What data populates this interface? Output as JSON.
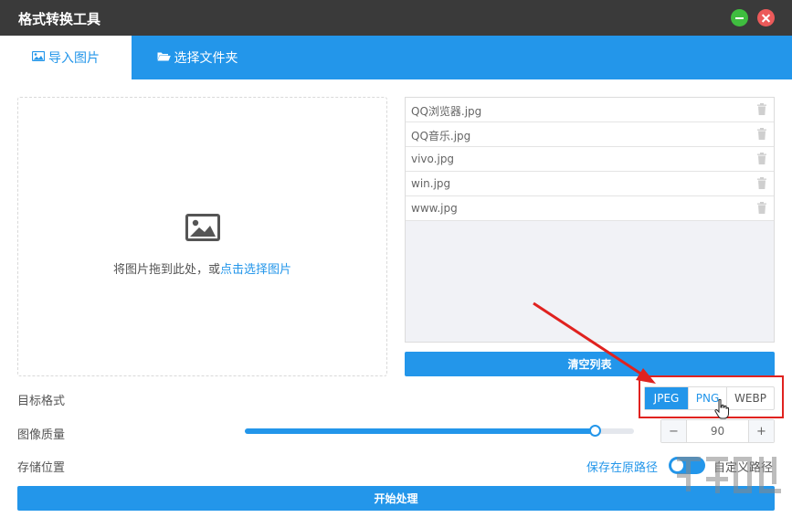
{
  "window": {
    "title": "格式转换工具"
  },
  "tabs": [
    {
      "label": "导入图片",
      "icon": "image-icon",
      "active": true
    },
    {
      "label": "选择文件夹",
      "icon": "folder-open-icon",
      "active": false
    }
  ],
  "dropzone": {
    "hint_prefix": "将图片拖到此处，或",
    "hint_link": "点击选择图片",
    "icon": "image-icon"
  },
  "files": [
    {
      "name": "QQ浏览器.jpg"
    },
    {
      "name": "QQ音乐.jpg"
    },
    {
      "name": "vivo.jpg"
    },
    {
      "name": "win.jpg"
    },
    {
      "name": "www.jpg"
    }
  ],
  "clear_button": "清空列表",
  "target_format": {
    "label": "目标格式",
    "options": [
      "JPEG",
      "PNG",
      "WEBP"
    ],
    "selected": "JPEG"
  },
  "quality": {
    "label": "图像质量",
    "value": "90",
    "slider_percent": 90,
    "minus": "−",
    "plus": "+"
  },
  "storage": {
    "label": "存储位置",
    "original_path": "保存在原路径",
    "custom_path": "自定义路径",
    "toggle_on": true
  },
  "start_button": "开始处理",
  "colors": {
    "accent": "#2396ea",
    "titlebar": "#3a3a3a",
    "highlight": "#e0221f"
  }
}
